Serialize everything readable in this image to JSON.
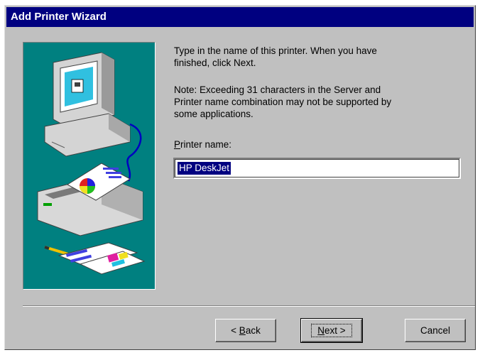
{
  "window": {
    "title": "Add Printer Wizard"
  },
  "content": {
    "instruction_line1": "Type in the name of this printer.  When you have",
    "instruction_line2": "finished, click Next.",
    "note_line1": "Note:  Exceeding 31 characters in the Server and",
    "note_line2": "Printer name combination may not be supported by",
    "note_line3": "some applications.",
    "printer_name_label_mnemonic": "P",
    "printer_name_label_rest": "rinter name:",
    "printer_name_value": "HP DeskJet"
  },
  "buttons": {
    "back_prefix": "< ",
    "back_mnemonic": "B",
    "back_rest": "ack",
    "next_prefix": "",
    "next_mnemonic": "N",
    "next_rest": "ext >",
    "cancel_label": "Cancel"
  },
  "colors": {
    "title_bar": "#000080",
    "dialog_face": "#c0c0c0",
    "art_background": "#008080",
    "selection": "#000080"
  }
}
